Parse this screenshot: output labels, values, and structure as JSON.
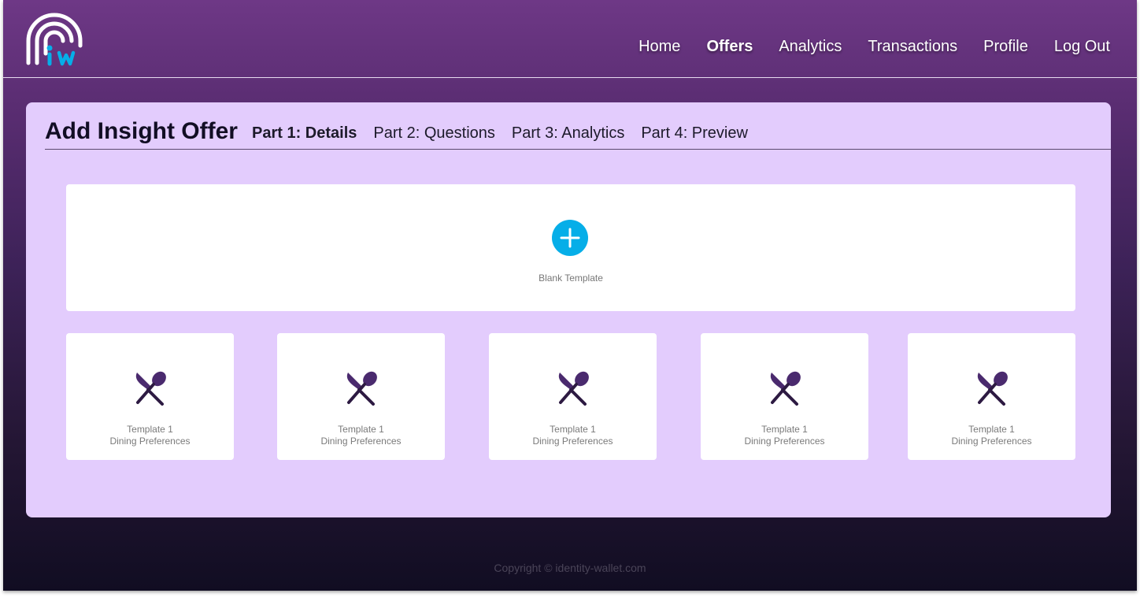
{
  "nav": {
    "items": [
      {
        "label": "Home"
      },
      {
        "label": "Offers"
      },
      {
        "label": "Analytics"
      },
      {
        "label": "Transactions"
      },
      {
        "label": "Profile"
      },
      {
        "label": "Log Out"
      }
    ],
    "active": "Offers"
  },
  "logo": {
    "icon": "fingerprint-logo-icon",
    "letters": "iw"
  },
  "page": {
    "title": "Add Insight Offer",
    "steps": [
      {
        "label": "Part 1: Details"
      },
      {
        "label": "Part 2: Questions"
      },
      {
        "label": "Part 3: Analytics"
      },
      {
        "label": "Part 4: Preview"
      }
    ],
    "active_step": "Part 1: Details"
  },
  "blank_template": {
    "label": "Blank Template",
    "icon": "plus-circle-icon"
  },
  "templates": [
    {
      "name": "Template 1",
      "category": "Dining Preferences",
      "icon": "fork-spoon-icon"
    },
    {
      "name": "Template 1",
      "category": "Dining Preferences",
      "icon": "fork-spoon-icon"
    },
    {
      "name": "Template 1",
      "category": "Dining Preferences",
      "icon": "fork-spoon-icon"
    },
    {
      "name": "Template 1",
      "category": "Dining Preferences",
      "icon": "fork-spoon-icon"
    },
    {
      "name": "Template 1",
      "category": "Dining Preferences",
      "icon": "fork-spoon-icon"
    }
  ],
  "footer": {
    "copyright": "Copyright © identity-wallet.com"
  },
  "colors": {
    "accent": "#06aee8",
    "panel": "#e3ccfd",
    "icon": "#3b1f55"
  }
}
